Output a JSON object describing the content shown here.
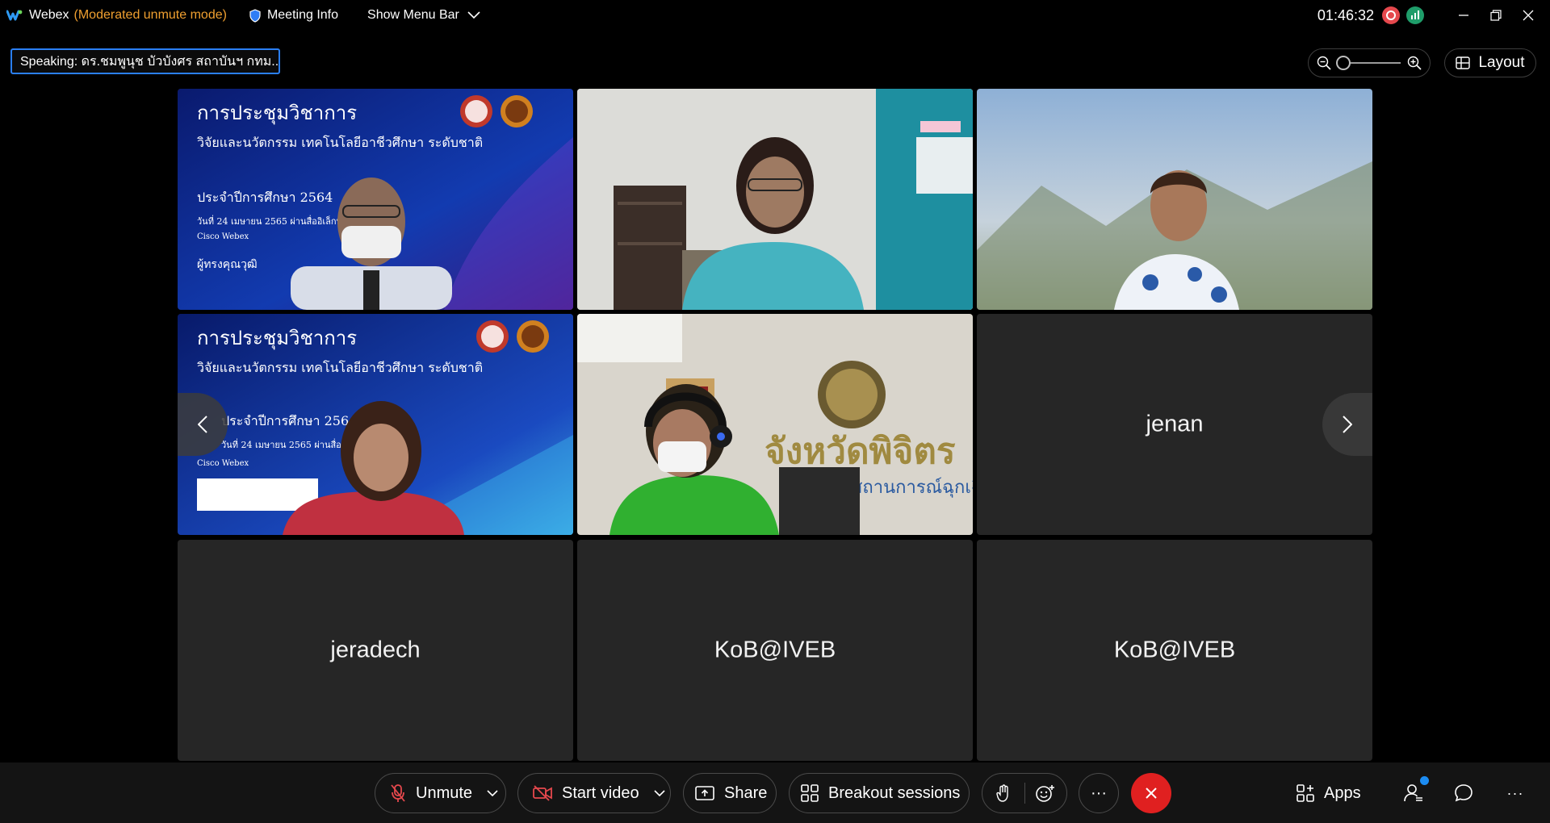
{
  "titlebar": {
    "app_name": "Webex",
    "mode": "(Moderated unmute mode)",
    "meeting_info": "Meeting Info",
    "show_menu_bar": "Show Menu Bar",
    "clock": "01:46:32",
    "icons": [
      "webex-logo-icon",
      "shield-icon",
      "chevron-down-icon",
      "recording-icon",
      "network-stats-icon",
      "minimize-icon",
      "restore-icon",
      "close-icon"
    ]
  },
  "speaking": {
    "text": "Speaking: ดร.ชมพูนุช บัวบังศร สถาบันฯ กทม.."
  },
  "layout_button": {
    "label": "Layout"
  },
  "slide": {
    "title": "การประชุมวิชาการ",
    "subtitle": "วิจัยและนวัตกรรม เทคโนโลยีอาชีวศึกษา ระดับชาติ",
    "year": "ประจำปีการศึกษา 2564",
    "date": "วันที่ 24 เมษายน 2565 ผ่านสื่ออิเล็กทรอนิกส์",
    "platform": "Cisco Webex",
    "guest": "ผู้ทรงคุณวุฒิ"
  },
  "wall_sign": {
    "line1": "จังหวัดพิจิตร",
    "line2": "สถานการณ์ฉุกเฉิน"
  },
  "participants": [
    {
      "name": "jenan"
    },
    {
      "name": "jeradech"
    },
    {
      "name": "KoB@IVEB"
    },
    {
      "name": "KoB@IVEB"
    }
  ],
  "controls": {
    "unmute": "Unmute",
    "start_video": "Start video",
    "share": "Share",
    "breakout": "Breakout sessions",
    "apps": "Apps",
    "more": "···",
    "overflow": "···"
  },
  "colors": {
    "accent_blue": "#2a7ff5",
    "mode_orange": "#f0a030",
    "end_red": "#e02020",
    "tile_bg": "#262626"
  }
}
